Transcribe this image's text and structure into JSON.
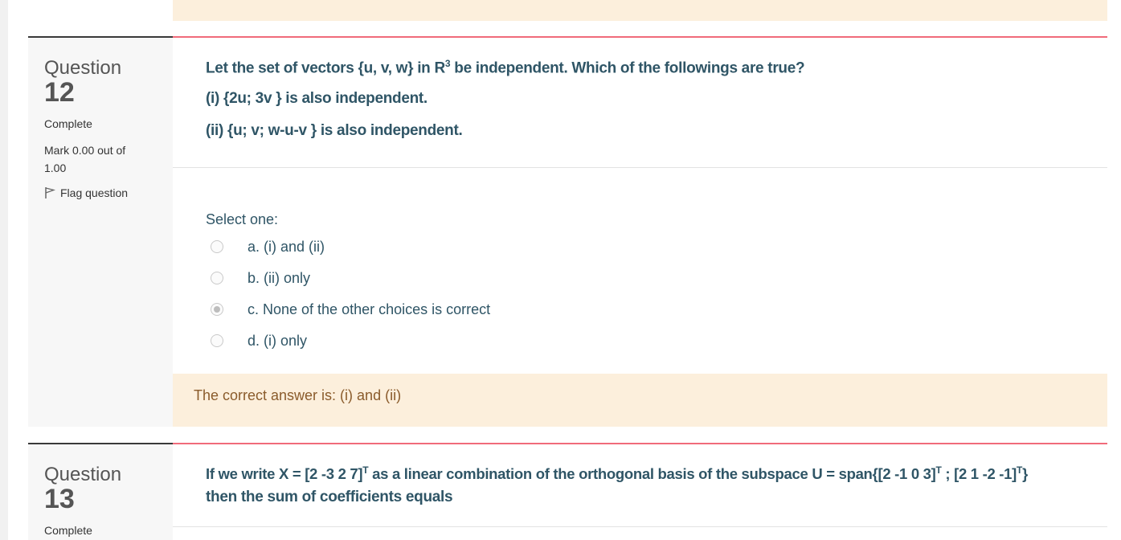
{
  "question12": {
    "label": "Question",
    "number": "12",
    "state": "Complete",
    "grade_line1": "Mark 0.00 out of",
    "grade_line2": "1.00",
    "flag_label": "Flag question",
    "text": {
      "line1_pre": "Let the set of vectors {u, v, w} in R",
      "line1_sup": "3",
      "line1_post": " be independent. Which of the followings are true?",
      "line2": "(i) {2u; 3v } is also independent.",
      "line3": "(ii) {u; v; w-u-v } is also independent."
    },
    "select_one": "Select one:",
    "options": [
      {
        "label": "a. (i) and (ii)",
        "checked": false
      },
      {
        "label": "b. (ii) only",
        "checked": false
      },
      {
        "label": "c. None of the other choices is correct",
        "checked": true
      },
      {
        "label": "d. (i) only",
        "checked": false
      }
    ],
    "feedback": "The correct answer is: (i) and (ii)"
  },
  "question13": {
    "label": "Question",
    "number": "13",
    "state": "Complete",
    "text": {
      "l1_a": "If we write X = [2 -3 2 7]",
      "l1_sup1": "T",
      "l1_b": " as a linear combination of the orthogonal basis of the subspace U = span{[2 -1 0 3]",
      "l1_sup2": "T",
      "l1_c": " ; [2 1 -2 -1]",
      "l1_sup3": "T",
      "l1_d": "}",
      "line2": "then the sum of coefficients equals"
    }
  },
  "icons": {
    "flag": "flag-icon",
    "radio": "radio-button"
  },
  "colors": {
    "accent_line": "#f06b7a",
    "question_text": "#2f5566",
    "feedback_bg": "#fcefdc",
    "feedback_text": "#8a5b2b"
  }
}
